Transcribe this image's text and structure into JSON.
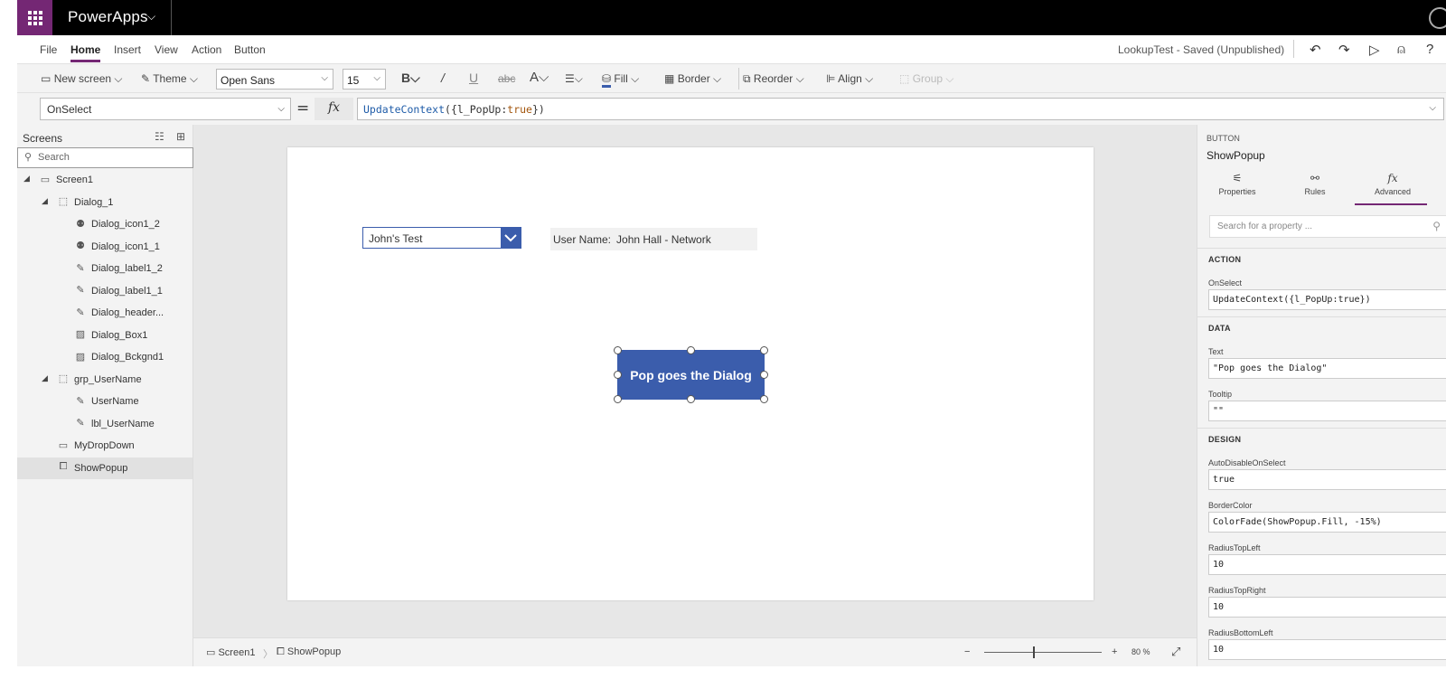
{
  "app": {
    "name": "PowerApps",
    "status": "LookupTest - Saved (Unpublished)"
  },
  "menu": [
    "File",
    "Home",
    "Insert",
    "View",
    "Action",
    "Button"
  ],
  "toolbar": {
    "new_screen": "New screen",
    "theme": "Theme",
    "font": "Open Sans",
    "font_size": "15",
    "fill": "Fill",
    "border": "Border",
    "reorder": "Reorder",
    "align": "Align",
    "group": "Group"
  },
  "formula_bar": {
    "property": "OnSelect",
    "equals": "=",
    "fx": "fx",
    "fn": "UpdateContext",
    "open": "({",
    "var": "l_PopUp",
    "colon": ":",
    "kw": "true",
    "close": "})"
  },
  "tree": {
    "title": "Screens",
    "search_placeholder": "Search",
    "items": [
      {
        "label": "Screen1",
        "level": 0,
        "icon": "screen"
      },
      {
        "label": "Dialog_1",
        "level": 1,
        "icon": "group"
      },
      {
        "label": "Dialog_icon1_2",
        "level": 2,
        "icon": "icons"
      },
      {
        "label": "Dialog_icon1_1",
        "level": 2,
        "icon": "icons"
      },
      {
        "label": "Dialog_label1_2",
        "level": 2,
        "icon": "label"
      },
      {
        "label": "Dialog_label1_1",
        "level": 2,
        "icon": "label"
      },
      {
        "label": "Dialog_header...",
        "level": 2,
        "icon": "label"
      },
      {
        "label": "Dialog_Box1",
        "level": 2,
        "icon": "image"
      },
      {
        "label": "Dialog_Bckgnd1",
        "level": 2,
        "icon": "image"
      },
      {
        "label": "grp_UserName",
        "level": 1,
        "icon": "group"
      },
      {
        "label": "UserName",
        "level": 2,
        "icon": "label"
      },
      {
        "label": "lbl_UserName",
        "level": 2,
        "icon": "label"
      },
      {
        "label": "MyDropDown",
        "level": 1,
        "icon": "dropdown"
      },
      {
        "label": "ShowPopup",
        "level": 1,
        "icon": "button",
        "selected": true
      }
    ]
  },
  "canvas": {
    "dropdown_value": "John's Test",
    "user_name_label": "User Name:",
    "user_name_value": "John Hall - Network",
    "button_text": "Pop goes the Dialog"
  },
  "statusbar": {
    "screen": "Screen1",
    "control": "ShowPopup",
    "zoom_minus": "−",
    "zoom_plus": "+",
    "zoom": "80",
    "zoom_unit": "%"
  },
  "properties_panel": {
    "type": "BUTTON",
    "name": "ShowPopup",
    "tabs": [
      {
        "label": "Properties"
      },
      {
        "label": "Rules"
      },
      {
        "label": "Advanced",
        "active": true
      }
    ],
    "search_placeholder": "Search for a property ...",
    "sections": [
      {
        "title": "ACTION",
        "fields": [
          {
            "label": "OnSelect",
            "value": "UpdateContext({l_PopUp:true})"
          }
        ]
      },
      {
        "title": "DATA",
        "fields": [
          {
            "label": "Text",
            "value": "\"Pop goes the Dialog\""
          },
          {
            "label": "Tooltip",
            "value": "\"\""
          }
        ]
      },
      {
        "title": "DESIGN",
        "fields": [
          {
            "label": "AutoDisableOnSelect",
            "value": "true"
          },
          {
            "label": "BorderColor",
            "value": "ColorFade(ShowPopup.Fill, -15%)"
          },
          {
            "label": "RadiusTopLeft",
            "value": "10"
          },
          {
            "label": "RadiusTopRight",
            "value": "10"
          },
          {
            "label": "RadiusBottomLeft",
            "value": "10"
          }
        ]
      }
    ]
  },
  "colors": {
    "brand": "#742774",
    "button": "#3b5dac",
    "topbar": "#000000"
  }
}
